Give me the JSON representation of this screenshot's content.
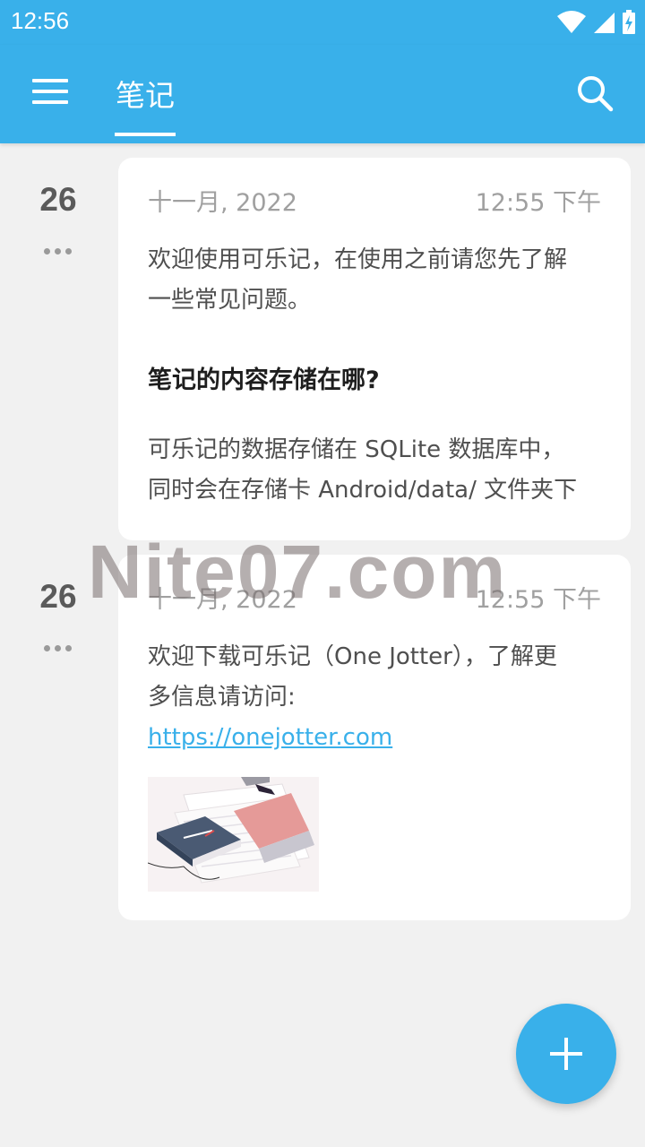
{
  "status_bar": {
    "time": "12:56",
    "icons": [
      "wifi-icon",
      "signal-icon",
      "battery-icon"
    ]
  },
  "app_bar": {
    "menu_icon": "menu-icon",
    "tab_label": "笔记",
    "search_icon": "search-icon",
    "color": "#39b0ea"
  },
  "notes": [
    {
      "day": "26",
      "date": "十一月, 2022",
      "time": "12:55 下午",
      "intro_line1": "欢迎使用可乐记，在使用之前请您先了解",
      "intro_line2": "一些常见问题。",
      "heading": "笔记的内容存储在哪?",
      "body_line1": "可乐记的数据存储在 SQLite 数据库中，",
      "body_line2": "同时会在存储卡 Android/data/ 文件夹下"
    },
    {
      "day": "26",
      "date": "十一月, 2022",
      "time": "12:55 下午",
      "line1": "欢迎下载可乐记（One Jotter），了解更",
      "line2": "多信息请访问:",
      "link": "https://onejotter.com"
    }
  ],
  "watermark": "Nite07.com",
  "fab_icon": "add-icon"
}
